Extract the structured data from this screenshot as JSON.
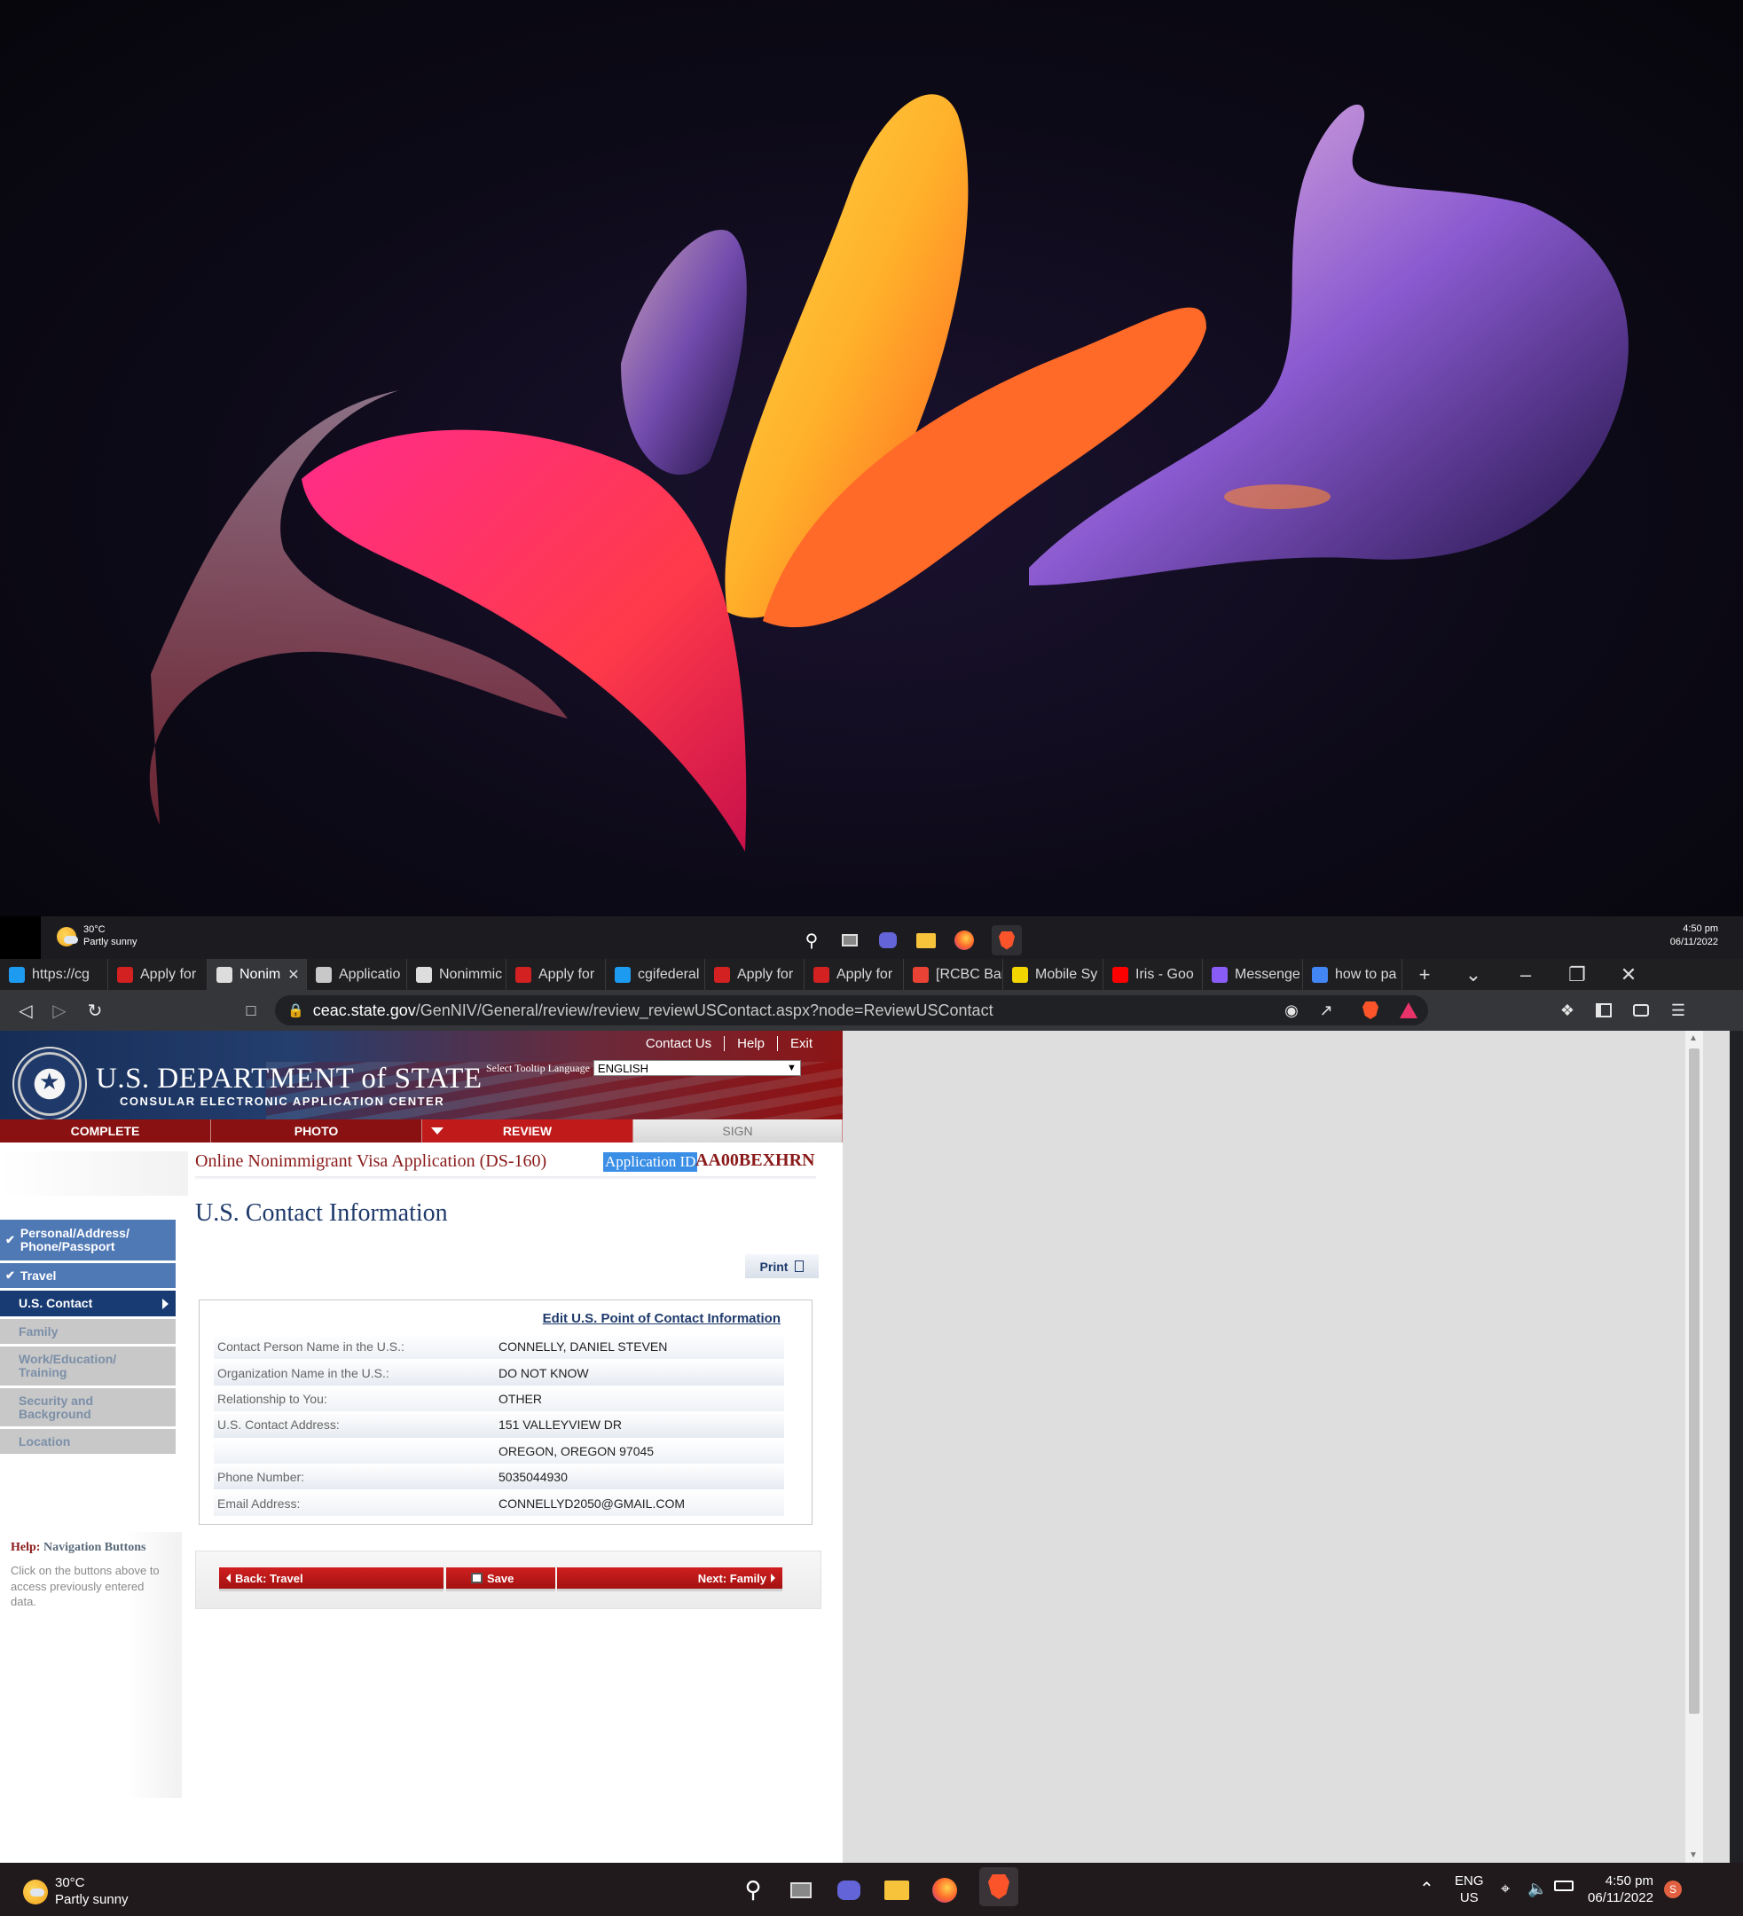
{
  "desktop": {
    "weather": {
      "temp": "30°C",
      "condition": "Partly sunny"
    },
    "clock": {
      "time": "4:50 pm",
      "date": "06/11/2022"
    }
  },
  "browser": {
    "tabs": [
      {
        "label": "https://cg",
        "color": "#1d9bf0"
      },
      {
        "label": "Apply for",
        "color": "#d32020"
      },
      {
        "label": "Nonim",
        "color": "#dddddd",
        "active": true
      },
      {
        "label": "Applicatio",
        "color": "#c8c8c8"
      },
      {
        "label": "Nonimmic",
        "color": "#dddddd"
      },
      {
        "label": "Apply for",
        "color": "#d32020"
      },
      {
        "label": "cgifederal",
        "color": "#1d9bf0"
      },
      {
        "label": "Apply for",
        "color": "#d32020"
      },
      {
        "label": "Apply for",
        "color": "#d32020"
      },
      {
        "label": "[RCBC Bar",
        "color": "#ea4335"
      },
      {
        "label": "Mobile Sy",
        "color": "#f2d600"
      },
      {
        "label": "Iris - Goo",
        "color": "#ff0000"
      },
      {
        "label": "Messenge",
        "color": "#8a5cf6"
      },
      {
        "label": "how to pa",
        "color": "#4285f4"
      }
    ],
    "close_tab_glyph": "✕",
    "new_tab_glyph": "+",
    "url_domain": "ceac.state.gov",
    "url_path": "/GenNIV/General/review/review_reviewUSContact.aspx?node=ReviewUSContact"
  },
  "page": {
    "toplinks": [
      "Contact Us",
      "Help",
      "Exit"
    ],
    "dept_title": "U.S. DEPARTMENT of STATE",
    "dept_subtitle": "CONSULAR ELECTRONIC APPLICATION CENTER",
    "tooltip_label": "Select Tooltip Language",
    "tooltip_value": "ENGLISH",
    "steps": [
      {
        "label": "COMPLETE",
        "state": "done"
      },
      {
        "label": "PHOTO",
        "state": "done"
      },
      {
        "label": "REVIEW",
        "state": "current"
      },
      {
        "label": "SIGN",
        "state": "todo"
      }
    ],
    "app_title": "Online Nonimmigrant Visa Application (DS-160)",
    "app_id_label": "Application ID",
    "app_id": "AA00BEXHRN",
    "left_nav": [
      {
        "label": "Personal/Address/ Phone/Passport",
        "state": "done"
      },
      {
        "label": "Travel",
        "state": "done"
      },
      {
        "label": "U.S. Contact",
        "state": "current"
      },
      {
        "label": "Family",
        "state": "disabled"
      },
      {
        "label": "Work/Education/ Training",
        "state": "disabled"
      },
      {
        "label": "Security and Background",
        "state": "disabled"
      },
      {
        "label": "Location",
        "state": "disabled"
      }
    ],
    "help_title_prefix": "Help:",
    "help_title": "Navigation Buttons",
    "help_text": "Click on the buttons above to access previously entered data.",
    "heading": "U.S. Contact Information",
    "print_label": "Print",
    "edit_link": "Edit U.S. Point of Contact Information",
    "rows": [
      {
        "label": "Contact Person Name in the U.S.:",
        "value": "CONNELLY, DANIEL STEVEN"
      },
      {
        "label": "Organization Name in the U.S.:",
        "value": "DO NOT KNOW"
      },
      {
        "label": "Relationship to You:",
        "value": "OTHER"
      },
      {
        "label": "U.S. Contact Address:",
        "value": "151 VALLEYVIEW DR"
      },
      {
        "label": "",
        "value": "OREGON, OREGON 97045"
      },
      {
        "label": "Phone Number:",
        "value": "5035044930"
      },
      {
        "label": "Email Address:",
        "value": "CONNELLYD2050@GMAIL.COM"
      }
    ],
    "btn_back": "Back: Travel",
    "btn_save": "Save",
    "btn_next": "Next: Family"
  },
  "taskbar": {
    "weather": {
      "temp": "30°C",
      "condition": "Partly sunny"
    },
    "lang": "ENG",
    "region": "US",
    "time": "4:50 pm",
    "date": "06/11/2022",
    "notif": "S"
  }
}
